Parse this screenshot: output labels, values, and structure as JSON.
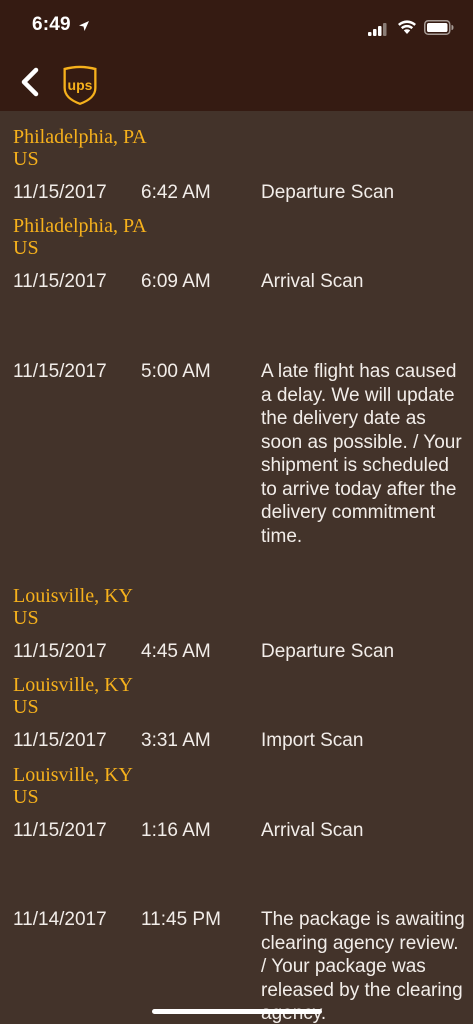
{
  "status_bar": {
    "time": "6:49"
  },
  "header": {
    "logo_text": "ups"
  },
  "events": [
    {
      "location": [
        "Philadelphia, PA",
        "US"
      ],
      "date": "11/15/2017",
      "time": "6:42 AM",
      "description": "Departure Scan"
    },
    {
      "location": [
        "Philadelphia, PA",
        "US"
      ],
      "date": "11/15/2017",
      "time": "6:09 AM",
      "description": "Arrival Scan"
    },
    {
      "location": [],
      "date": "11/15/2017",
      "time": "5:00 AM",
      "description": "A late flight has caused a delay. We will update the delivery date as soon as possible.  / Your shipment is scheduled to arrive today after the delivery commitment time."
    },
    {
      "location": [
        "Louisville, KY",
        "US"
      ],
      "date": "11/15/2017",
      "time": "4:45 AM",
      "description": "Departure Scan"
    },
    {
      "location": [
        "Louisville, KY",
        "US"
      ],
      "date": "11/15/2017",
      "time": "3:31 AM",
      "description": "Import Scan"
    },
    {
      "location": [
        "Louisville, KY",
        "US"
      ],
      "date": "11/15/2017",
      "time": "1:16 AM",
      "description": "Arrival Scan"
    },
    {
      "location": [],
      "date": "11/14/2017",
      "time": "11:45 PM",
      "description": "The package is awaiting clearing agency review. / Your package was released by the clearing agency."
    }
  ],
  "colors": {
    "header_bg": "#351b12",
    "content_bg": "#43332a",
    "location_text": "#f6b11c",
    "logo_gold": "#f6b11c"
  }
}
